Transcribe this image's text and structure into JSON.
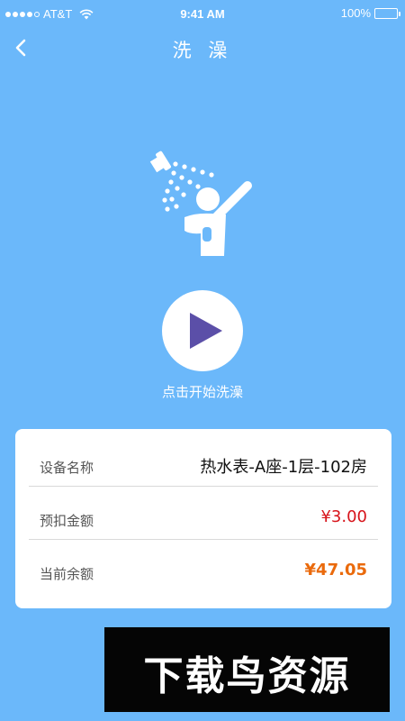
{
  "status_bar": {
    "carrier": "AT&T",
    "time": "9:41 AM",
    "battery": "100%"
  },
  "nav": {
    "title": "洗 澡",
    "back_icon": "chevron-left-icon"
  },
  "illustration": {
    "icon": "shower-person-icon"
  },
  "start": {
    "icon": "play-icon",
    "hint": "点击开始洗澡",
    "accent_color": "#5b4fa8"
  },
  "info": {
    "rows": [
      {
        "label": "设备名称",
        "value": "热水表-A座-1层-102房"
      },
      {
        "label": "预扣金额",
        "value": "¥3.00"
      },
      {
        "label": "当前余额",
        "value": "¥47.05"
      }
    ]
  },
  "watermark": {
    "text": "下载鸟资源"
  },
  "colors": {
    "background": "#6bb8fa",
    "deposit": "#d7141b",
    "balance": "#ea6a0c"
  }
}
